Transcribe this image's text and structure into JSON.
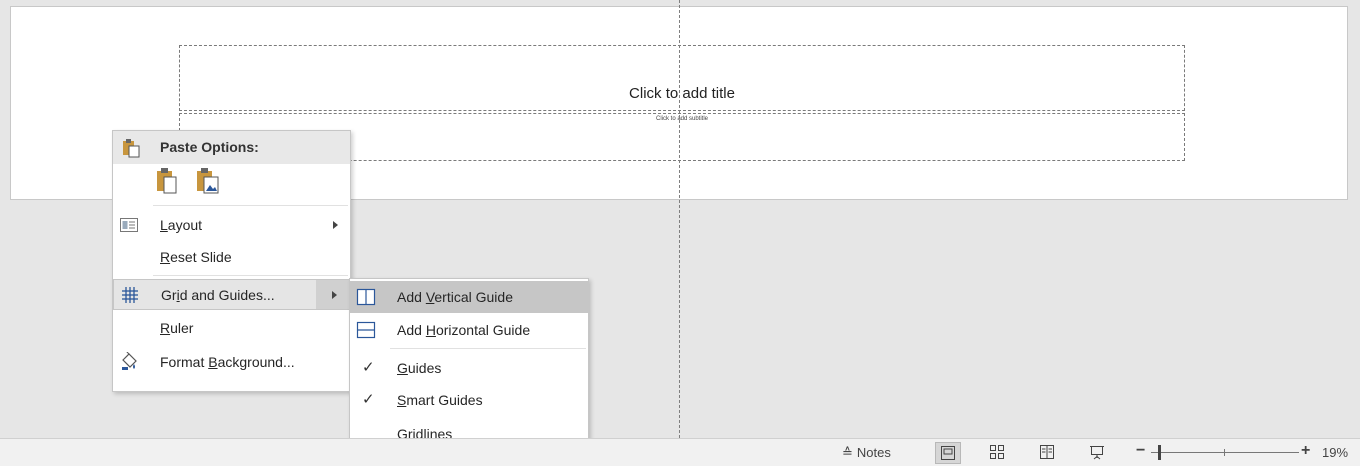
{
  "slide": {
    "title_placeholder": "Click to add title",
    "subtitle_placeholder": "Click to add subtitle"
  },
  "context_menu": {
    "paste_header": "Paste Options:",
    "paste_buttons": [
      "use-destination-theme",
      "picture"
    ],
    "items": [
      {
        "id": "layout",
        "pre": "",
        "ul": "L",
        "post": "ayout",
        "has_submenu": true
      },
      {
        "id": "reset-slide",
        "pre": "",
        "ul": "R",
        "post": "eset Slide",
        "has_submenu": false
      },
      {
        "id": "grid-and-guides",
        "pre": "Gr",
        "ul": "i",
        "post": "d and Guides...",
        "has_submenu": true
      },
      {
        "id": "ruler",
        "pre": "",
        "ul": "R",
        "post": "uler",
        "has_submenu": false
      },
      {
        "id": "format-background",
        "pre": "Format ",
        "ul": "B",
        "post": "ackground...",
        "has_submenu": false
      }
    ]
  },
  "submenu": {
    "items": [
      {
        "id": "add-vertical-guide",
        "pre": "Add ",
        "ul": "V",
        "post": "ertical Guide",
        "checked": false,
        "highlighted": true
      },
      {
        "id": "add-horizontal-guide",
        "pre": "Add ",
        "ul": "H",
        "post": "orizontal Guide",
        "checked": false,
        "highlighted": false
      },
      {
        "id": "guides",
        "pre": "",
        "ul": "G",
        "post": "uides",
        "checked": true,
        "highlighted": false
      },
      {
        "id": "smart-guides",
        "pre": "",
        "ul": "S",
        "post": "mart Guides",
        "checked": true,
        "highlighted": false
      },
      {
        "id": "gridlines",
        "pre": "Grid",
        "ul": "l",
        "post": "ines",
        "checked": false,
        "highlighted": false
      }
    ]
  },
  "statusbar": {
    "notes_label": "Notes",
    "zoom_level": "19%",
    "zoom_fraction": 0.05,
    "active_view": "normal",
    "icons": [
      "normal-view-icon",
      "slide-sorter-icon",
      "reading-view-icon",
      "slide-show-icon"
    ]
  },
  "colors": {
    "workspace": "#e6e6e6",
    "highlight": "#c6c6c6",
    "menu_bg": "#ffffff",
    "icon_blue": "#2b579a",
    "paste_gold": "#c8963e"
  }
}
